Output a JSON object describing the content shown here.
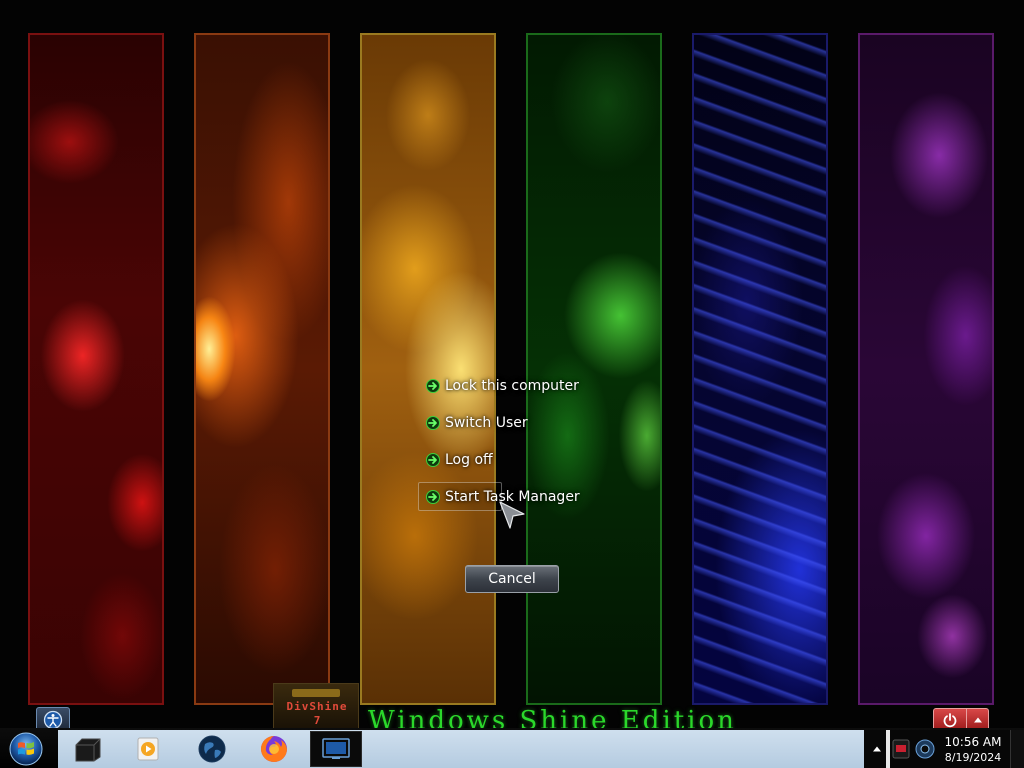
{
  "security_menu": {
    "items": [
      {
        "label": "Lock this computer"
      },
      {
        "label": "Switch User"
      },
      {
        "label": "Log off"
      },
      {
        "label": "Start Task Manager"
      }
    ],
    "cancel_label": "Cancel"
  },
  "branding": {
    "logo_name": "DivShine",
    "logo_number": "7",
    "edition_text": "Windows Shine Edition"
  },
  "taskbar": {
    "pinned": [
      {
        "icon": "computer-icon"
      },
      {
        "icon": "media-player-icon"
      },
      {
        "icon": "globe-icon"
      },
      {
        "icon": "firefox-icon"
      },
      {
        "icon": "remote-desktop-icon",
        "active": true
      }
    ]
  },
  "tray": {
    "time": "10:56 AM",
    "date": "8/19/2024"
  },
  "colors": {
    "accent_green": "#2bd82b",
    "shutdown_red": "#c83030",
    "taskbar_light": "#c4d6e8"
  }
}
